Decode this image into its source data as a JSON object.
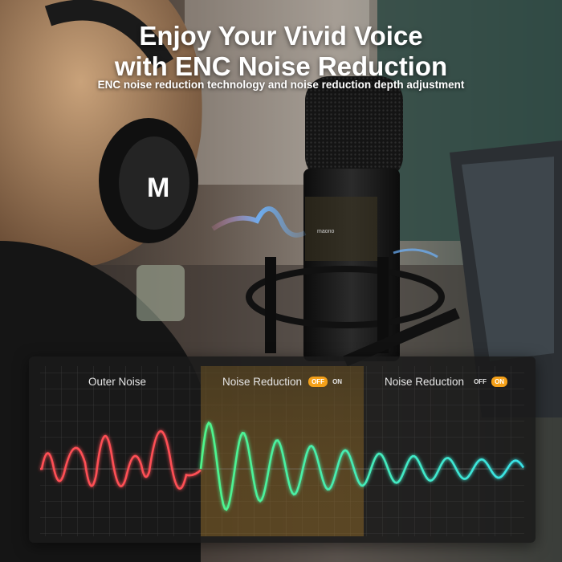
{
  "headline": {
    "line1": "Enjoy Your Vivid Voice",
    "line2": "with ENC Noise Reduction"
  },
  "subheadline": "ENC noise reduction technology and noise reduction depth adjustment",
  "headphone_logo": "M",
  "mic_brand": "maono",
  "panel": {
    "sections": [
      {
        "title": "Outer Noise"
      },
      {
        "title": "Noise Reduction",
        "toggle": {
          "off": "OFF",
          "on": "ON",
          "active": "OFF"
        }
      },
      {
        "title": "Noise Reduction",
        "toggle": {
          "off": "OFF",
          "on": "ON",
          "active": "ON"
        }
      }
    ]
  },
  "colors": {
    "toggle_active": "#f4a019",
    "noise_wave": "#ff4f55",
    "reduced_wave_start": "#4ff58a",
    "reduced_wave_end": "#39e3e8",
    "panel_background": "#1a1a1a"
  }
}
